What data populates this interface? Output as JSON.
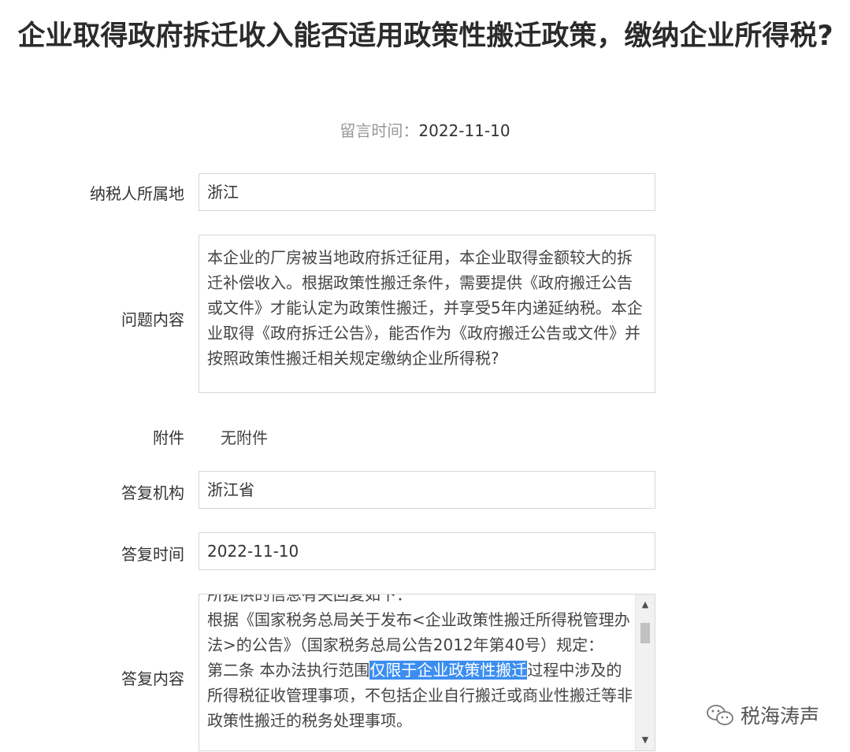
{
  "title": "企业取得政府拆迁收入能否适用政策性搬迁政策，缴纳企业所得税?",
  "message_time": {
    "label": "留言时间：",
    "value": "2022-11-10"
  },
  "fields": {
    "region": {
      "label": "纳税人所属地",
      "value": "浙江"
    },
    "question": {
      "label": "问题内容",
      "value": "本企业的厂房被当地政府拆迁征用，本企业取得金额较大的拆迁补偿收入。根据政策性搬迁条件，需要提供《政府搬迁公告或文件》才能认定为政策性搬迁，并享受5年内递延纳税。本企业取得《政府拆迁公告》，能否作为《政府搬迁公告或文件》并按照政策性搬迁相关规定缴纳企业所得税?"
    },
    "attachment": {
      "label": "附件",
      "value": "无附件"
    },
    "reply_org": {
      "label": "答复机构",
      "value": "浙江省"
    },
    "reply_time": {
      "label": "答复时间",
      "value": "2022-11-10"
    },
    "reply_content": {
      "label": "答复内容",
      "cut_line": "所提供的信息有关回复如下：",
      "line1": "根据《国家税务总局关于发布<企业政策性搬迁所得税管理办法>的公告》（国家税务总局公告2012年第40号）规定：",
      "line2_before": "第二条  本办法执行范围",
      "line2_highlight": "仅限于企业政策性搬迁",
      "line2_after": "过程中涉及的所得税征收管理事项，不包括企业自行搬迁或商业性搬迁等非政策性搬迁的税务处理事项。"
    }
  },
  "scrollbar": {
    "up_arrow": "▲",
    "down_arrow": "▼"
  },
  "watermark": {
    "text": "税海涛声",
    "icon": "wechat-icon"
  }
}
